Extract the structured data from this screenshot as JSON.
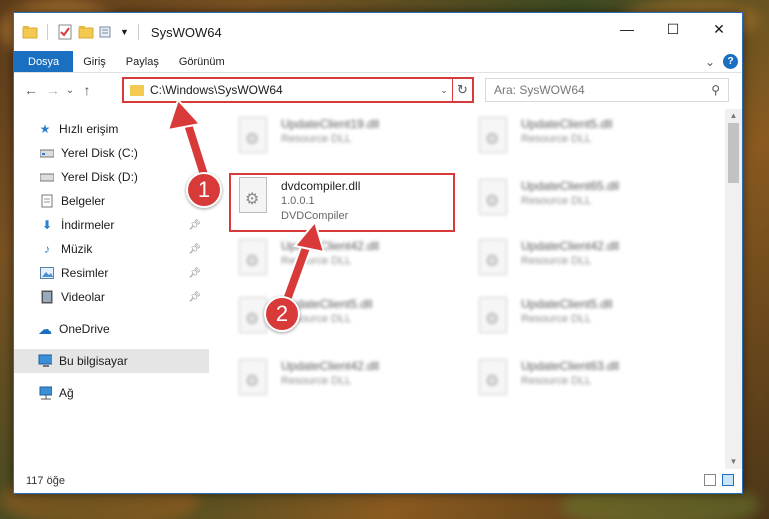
{
  "window": {
    "title": "SysWOW64",
    "minimize": "—",
    "maximize": "☐",
    "close": "✕"
  },
  "ribbon": {
    "tabs": [
      "Dosya",
      "Giriş",
      "Paylaş",
      "Görünüm"
    ],
    "expand": "⌄",
    "help": "?"
  },
  "nav": {
    "back": "←",
    "forward": "→",
    "recent": "⌄",
    "up": "↑",
    "address": "C:\\Windows\\SysWOW64",
    "refresh": "↻",
    "search_placeholder": "Ara: SysWOW64"
  },
  "sidebar": {
    "items": [
      {
        "label": "Hızlı erişim",
        "icon": "star-icon"
      },
      {
        "label": "Yerel Disk (C:)",
        "icon": "drive-icon"
      },
      {
        "label": "Yerel Disk (D:)",
        "icon": "drive-icon"
      },
      {
        "label": "Belgeler",
        "icon": "documents-icon"
      },
      {
        "label": "İndirmeler",
        "icon": "download-icon"
      },
      {
        "label": "Müzik",
        "icon": "music-icon"
      },
      {
        "label": "Resimler",
        "icon": "pictures-icon"
      },
      {
        "label": "Videolar",
        "icon": "video-icon"
      },
      {
        "label": "OneDrive",
        "icon": "cloud-icon"
      },
      {
        "label": "Bu bilgisayar",
        "icon": "computer-icon"
      },
      {
        "label": "Ağ",
        "icon": "network-icon"
      }
    ]
  },
  "files": {
    "left": [
      {
        "name": "UpdateClient19.dll",
        "type": "Resource DLL"
      },
      {
        "name": "dvdcompiler.dll",
        "version": "1.0.0.1",
        "desc": "DVDCompiler"
      },
      {
        "name": "UpdateClient42.dll",
        "type": "Resource DLL"
      },
      {
        "name": "UpdateClient5.dll",
        "type": "Resource DLL"
      },
      {
        "name": "UpdateClient42.dll",
        "type": "Resource DLL"
      }
    ],
    "right": [
      {
        "name": "UpdateClient5.dll",
        "type": "Resource DLL"
      },
      {
        "name": "UpdateClient65.dll",
        "type": "Resource DLL"
      },
      {
        "name": "UpdateClient42.dll",
        "type": "Resource DLL"
      },
      {
        "name": "UpdateClient5.dll",
        "type": "Resource DLL"
      },
      {
        "name": "UpdateClient63.dll",
        "type": "Resource DLL"
      }
    ]
  },
  "status": {
    "count": "117 öğe"
  },
  "annotations": {
    "step1": "1",
    "step2": "2"
  },
  "colors": {
    "accent": "#1a6fc1",
    "annotation": "#d83a3a"
  }
}
